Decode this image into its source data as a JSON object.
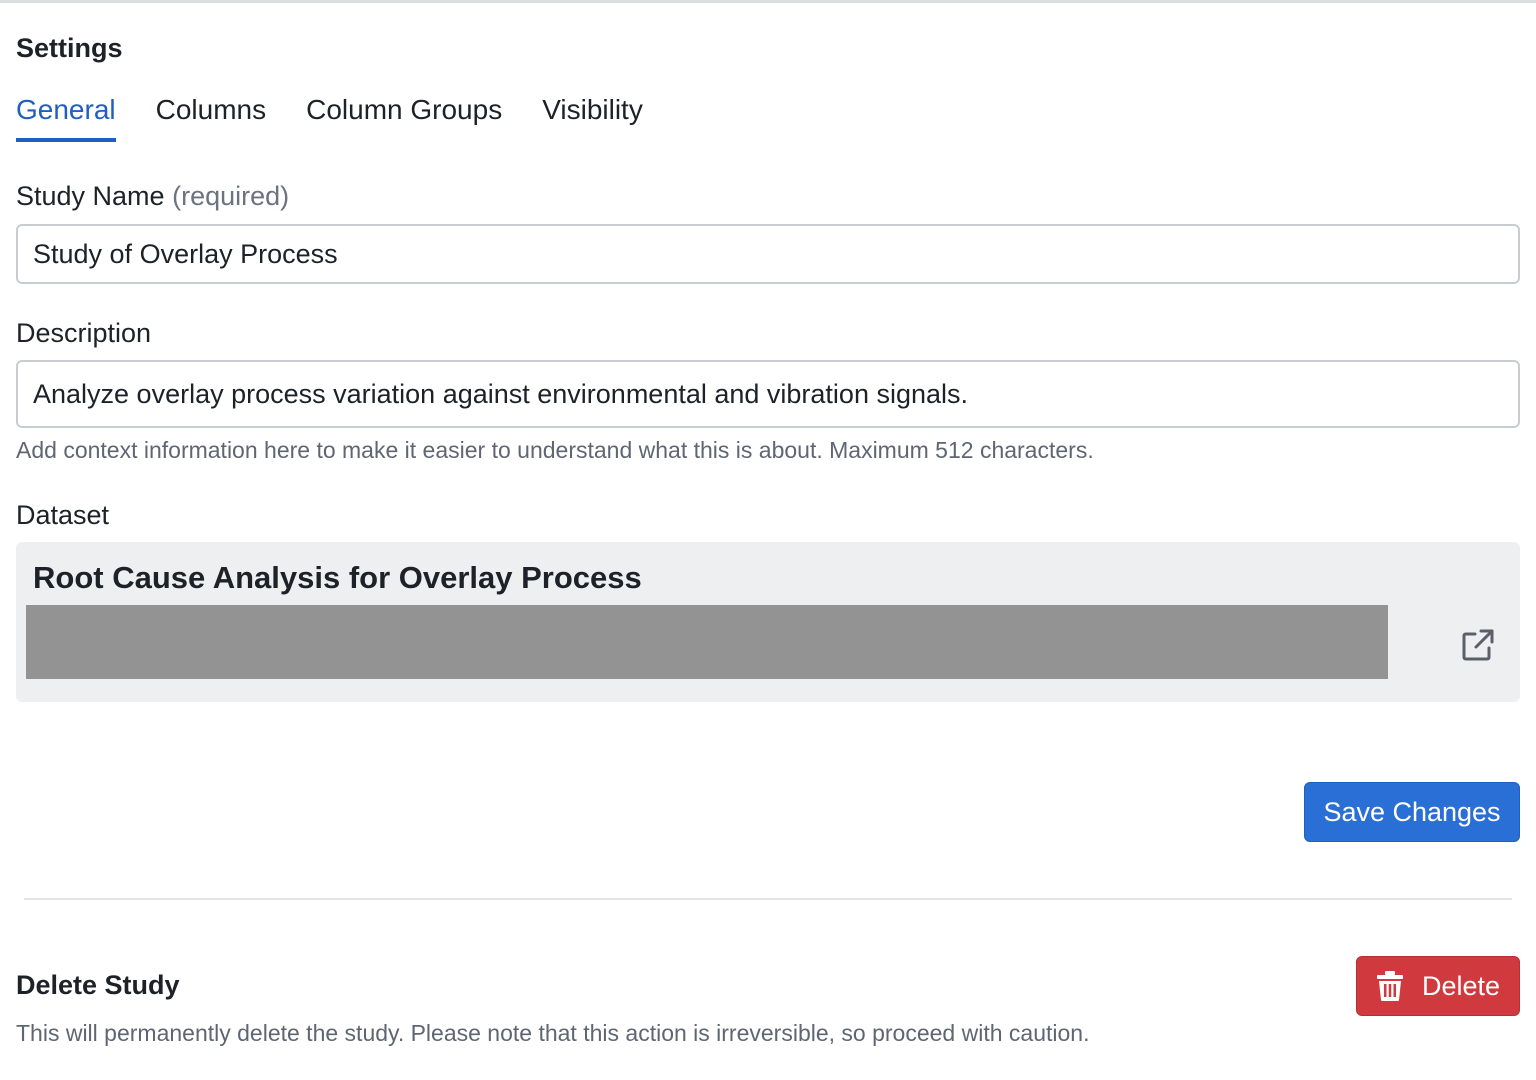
{
  "header": {
    "title": "Settings"
  },
  "tabs": [
    {
      "label": "General",
      "active": true
    },
    {
      "label": "Columns",
      "active": false
    },
    {
      "label": "Column Groups",
      "active": false
    },
    {
      "label": "Visibility",
      "active": false
    }
  ],
  "form": {
    "study_name": {
      "label": "Study Name",
      "required_note": "(required)",
      "value": "Study of Overlay Process"
    },
    "description": {
      "label": "Description",
      "value": "Analyze overlay process variation against environmental and vibration signals.",
      "help": "Add context information here to make it easier to understand what this is about. Maximum 512 characters."
    },
    "dataset": {
      "label": "Dataset",
      "name": "Root Cause Analysis for Overlay Process",
      "link_icon": "external-link-icon"
    },
    "save_label": "Save Changes"
  },
  "danger": {
    "title": "Delete Study",
    "description": "This will permanently delete the study. Please note that this action is irreversible, so proceed with caution.",
    "button_label": "Delete",
    "button_icon": "trash-icon"
  },
  "colors": {
    "accent": "#1f5fbf",
    "primary_button": "#2a6fd6",
    "danger_button": "#d03a3e",
    "dataset_background": "#eeeff1",
    "redaction": "#939393"
  }
}
